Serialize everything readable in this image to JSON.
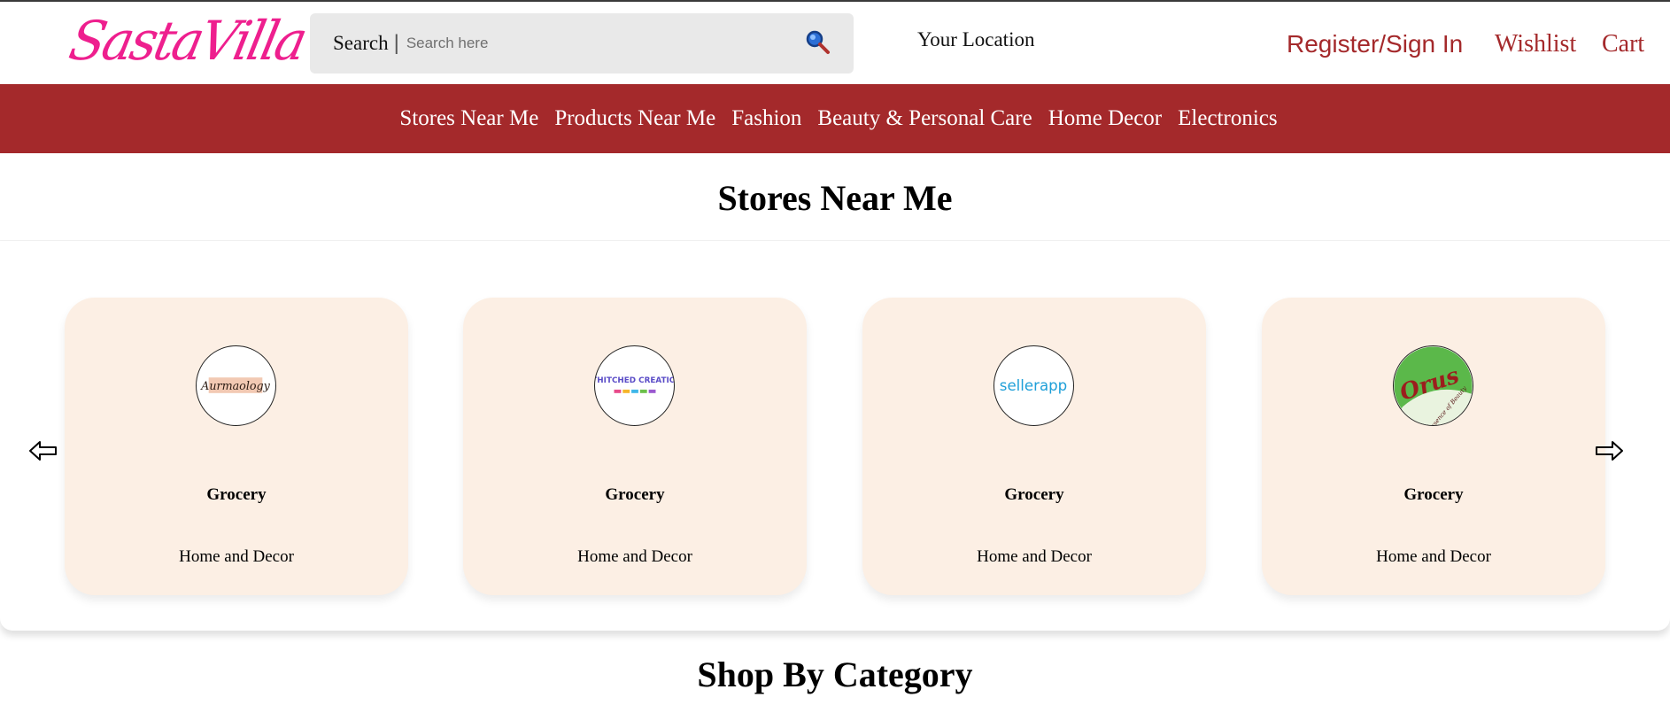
{
  "header": {
    "logo_text": "SastaVilla",
    "search_label": "Search",
    "search_separator": "|",
    "search_placeholder": "Search here",
    "location_label": "Your Location",
    "register_label": "Register/Sign In",
    "wishlist_label": "Wishlist",
    "cart_label": "Cart",
    "icons": {
      "search": "search-magnifier-icon"
    }
  },
  "nav": {
    "items": [
      {
        "label": "Stores Near Me"
      },
      {
        "label": "Products Near Me"
      },
      {
        "label": "Fashion"
      },
      {
        "label": "Beauty & Personal Care"
      },
      {
        "label": "Home Decor"
      },
      {
        "label": "Electronics"
      }
    ]
  },
  "stores_section": {
    "title": "Stores Near Me",
    "cards": [
      {
        "logo_text": "Aurmaology",
        "category": "Grocery",
        "subcategory": "Home and Decor"
      },
      {
        "logo_text": "GETHITCHED CREATIONS",
        "category": "Grocery",
        "subcategory": "Home and Decor"
      },
      {
        "logo_text": "sellerapp",
        "category": "Grocery",
        "subcategory": "Home and Decor"
      },
      {
        "logo_text": "Orus",
        "logo_subtext": "Essence of Beauty",
        "category": "Grocery",
        "subcategory": "Home and Decor"
      }
    ],
    "icons": {
      "prev": "arrow-left-icon",
      "next": "arrow-right-icon"
    }
  },
  "category_section": {
    "title": "Shop By Category"
  },
  "colors": {
    "brand_pink": "#ee1f8e",
    "brand_red": "#a4292b",
    "card_bg": "#fcefe4",
    "search_bg": "#e9e9e9"
  }
}
